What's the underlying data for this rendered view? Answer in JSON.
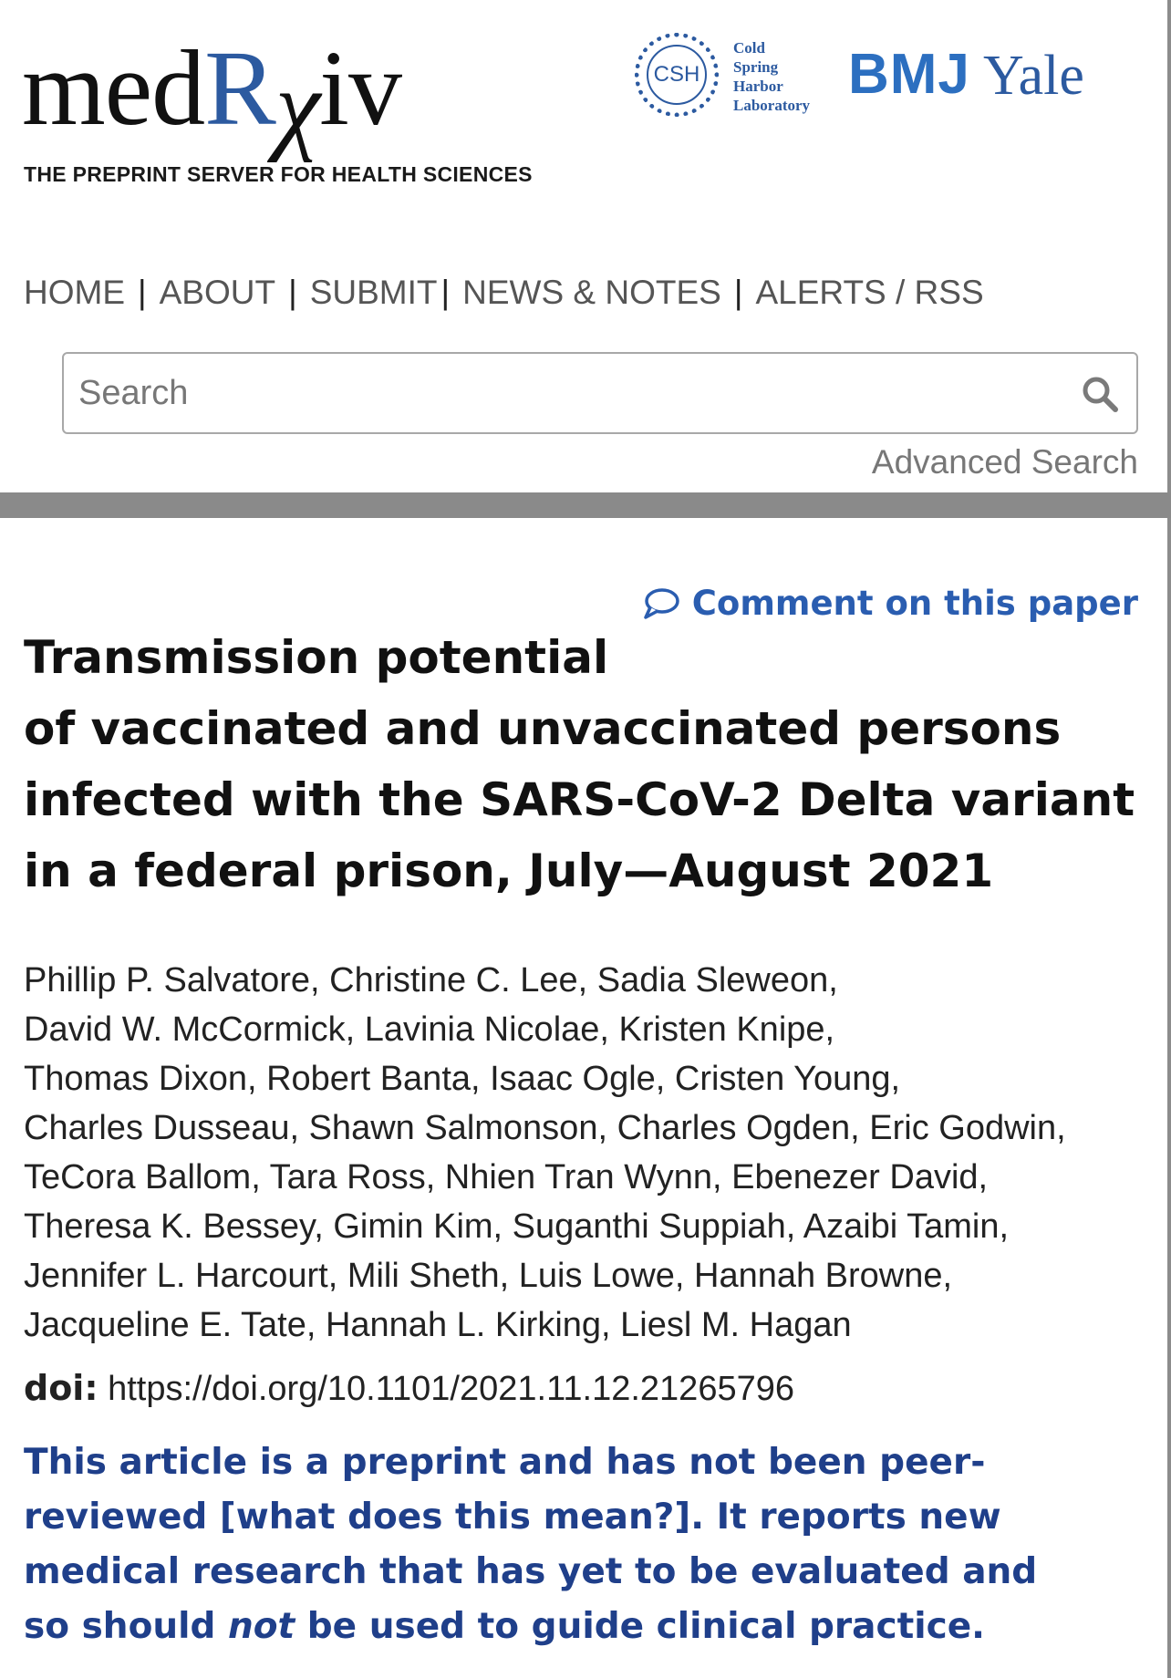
{
  "header": {
    "logo": {
      "part1": "med",
      "part2": "R",
      "part3": "χ",
      "part4": "iv"
    },
    "tagline": "THE PREPRINT SERVER FOR HEALTH SCIENCES",
    "partners": {
      "csh_monogram": "CSH",
      "csh_lines": [
        "Cold",
        "Spring",
        "Harbor",
        "Laboratory"
      ],
      "bmj": "BMJ",
      "yale": "Yale"
    }
  },
  "nav": {
    "items": [
      "HOME",
      "ABOUT",
      "SUBMIT",
      "NEWS & NOTES",
      "ALERTS / RSS"
    ],
    "separator": "|"
  },
  "search": {
    "placeholder": "Search",
    "advanced_label": "Advanced Search"
  },
  "article": {
    "comment_link": "Comment on this paper",
    "title_lines": [
      "Transmission potential",
      "of vaccinated and unvaccinated persons",
      "infected with the SARS-CoV-2 Delta variant",
      "in a federal prison, July—August 2021"
    ],
    "author_lines": [
      "Phillip P. Salvatore, Christine C. Lee, Sadia Sleweon,",
      "David W. McCormick, Lavinia Nicolae, Kristen Knipe,",
      "Thomas Dixon, Robert Banta, Isaac Ogle, Cristen Young,",
      "Charles Dusseau, Shawn Salmonson, Charles Ogden, Eric Godwin,",
      "TeCora Ballom, Tara Ross, Nhien Tran Wynn, Ebenezer David,",
      "Theresa K. Bessey, Gimin Kim, Suganthi Suppiah, Azaibi Tamin,",
      "Jennifer L. Harcourt, Mili Sheth, Luis Lowe, Hannah Browne,",
      "Jacqueline E. Tate, Hannah L. Kirking, Liesl M. Hagan"
    ],
    "doi_label": "doi:",
    "doi_url": "https://doi.org/10.1101/2021.11.12.21265796",
    "notice": {
      "line1": "This article is a preprint and has not been peer-",
      "line2_a": "reviewed ",
      "line2_link": "[what does this mean?]",
      "line2_b": ". It reports new",
      "line3": "medical research that has yet to be evaluated and",
      "line4_a": "so should ",
      "line4_em": "not",
      "line4_b": " be used to guide clinical practice."
    }
  },
  "colors": {
    "brand_blue": "#2c5aa0",
    "link_blue": "#2a5db0",
    "notice_blue": "#1f3f8a",
    "divider_gray": "#8a8a8a"
  },
  "icons": {
    "search": "search-icon",
    "comment": "comment-bubble-icon"
  }
}
